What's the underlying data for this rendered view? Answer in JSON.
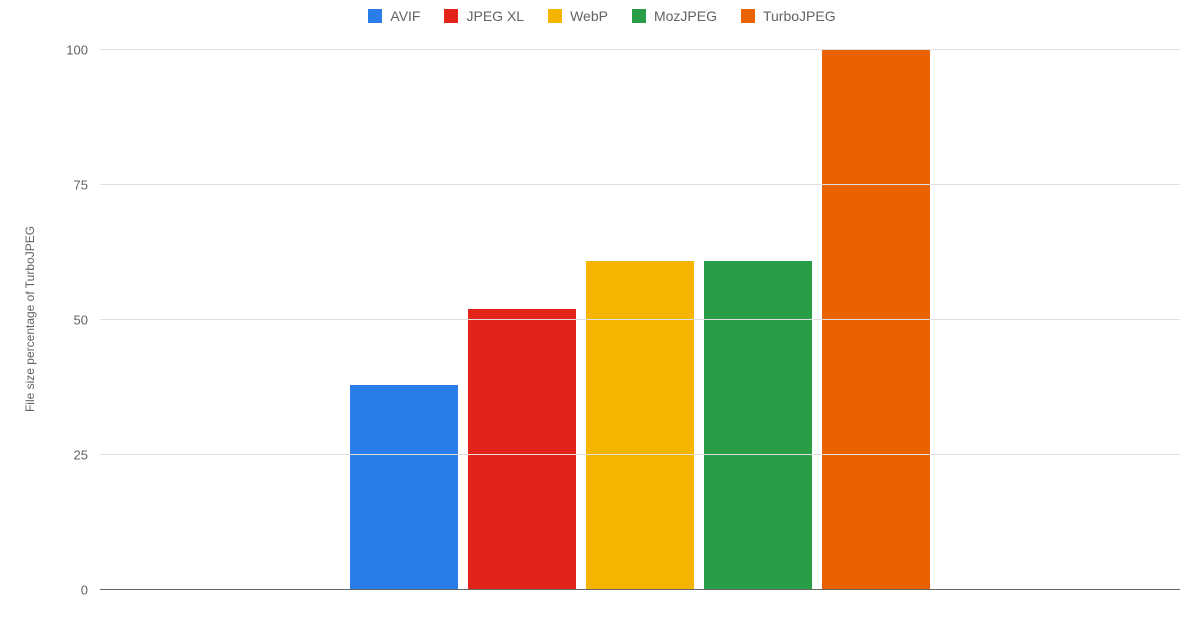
{
  "chart_data": {
    "type": "bar",
    "categories": [
      "AVIF",
      "JPEG XL",
      "WebP",
      "MozJPEG",
      "TurboJPEG"
    ],
    "values": [
      38,
      52,
      61,
      61,
      100
    ],
    "colors": [
      "#2a7cea",
      "#e2231a",
      "#f5b400",
      "#299e47",
      "#ea6100"
    ],
    "title": "",
    "xlabel": "",
    "ylabel": "File size percentage of TurboJPEG",
    "ylim": [
      0,
      100
    ],
    "yticks": [
      0,
      25,
      50,
      75,
      100
    ]
  }
}
